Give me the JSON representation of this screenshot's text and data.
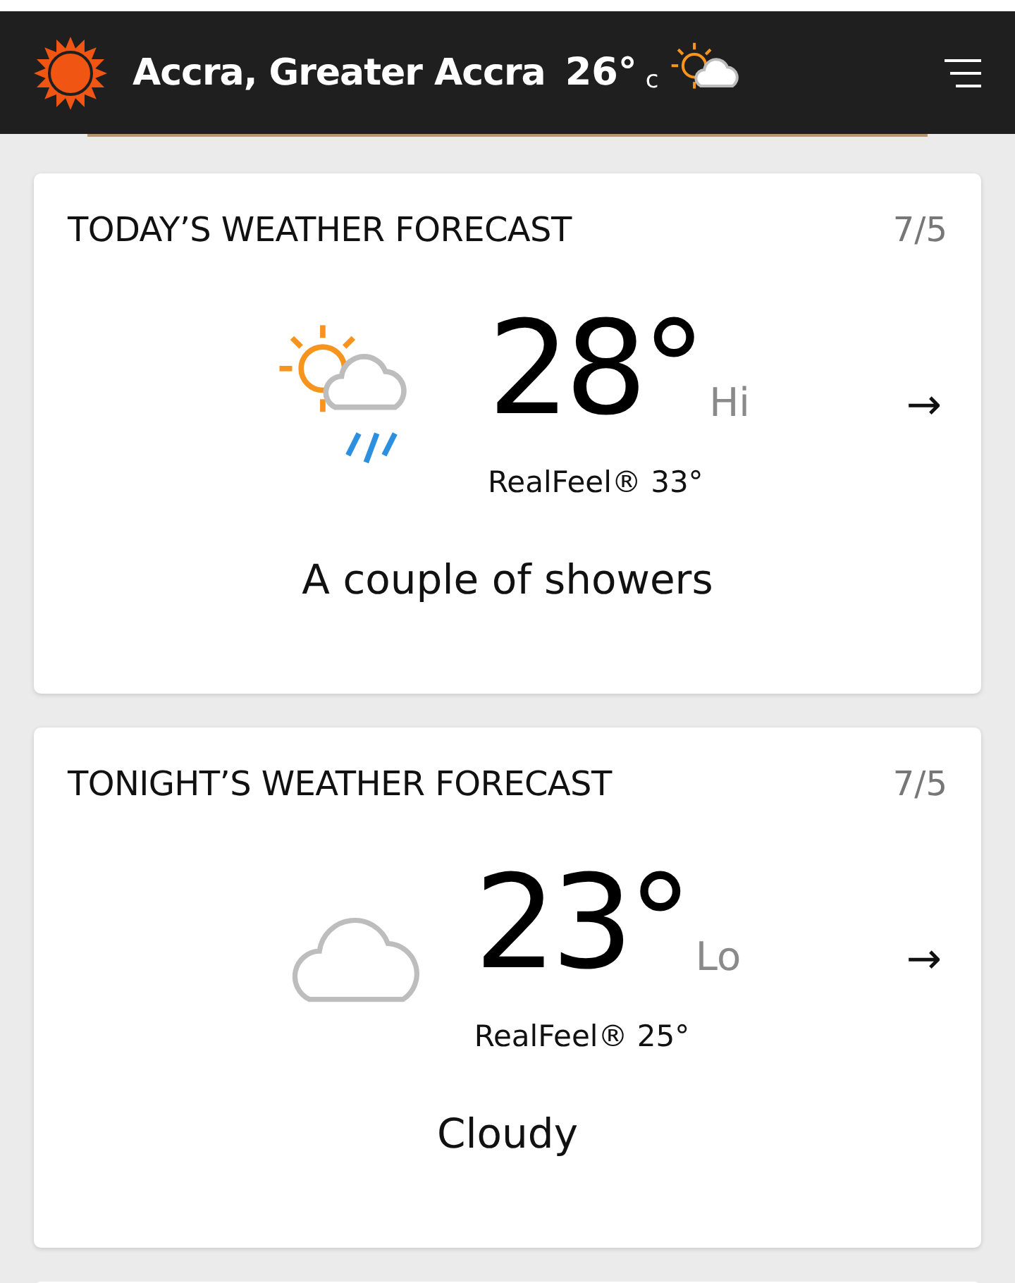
{
  "header": {
    "location": "Accra, Greater Accra",
    "temperature": "26°",
    "unit": "c",
    "kind": "partly-cloudy"
  },
  "forecasts": [
    {
      "title": "TODAY’S WEATHER FORECAST",
      "date": "7/5",
      "kind": "sun-cloud-rain",
      "temperature": "28°",
      "label": "Hi",
      "realfeel": "RealFeel® 33°",
      "phrase": "A couple of showers",
      "arrow": "→"
    },
    {
      "title": "TONIGHT’S WEATHER FORECAST",
      "date": "7/5",
      "kind": "cloud",
      "temperature": "23°",
      "label": "Lo",
      "realfeel": "RealFeel® 25°",
      "phrase": "Cloudy",
      "arrow": "→"
    }
  ]
}
